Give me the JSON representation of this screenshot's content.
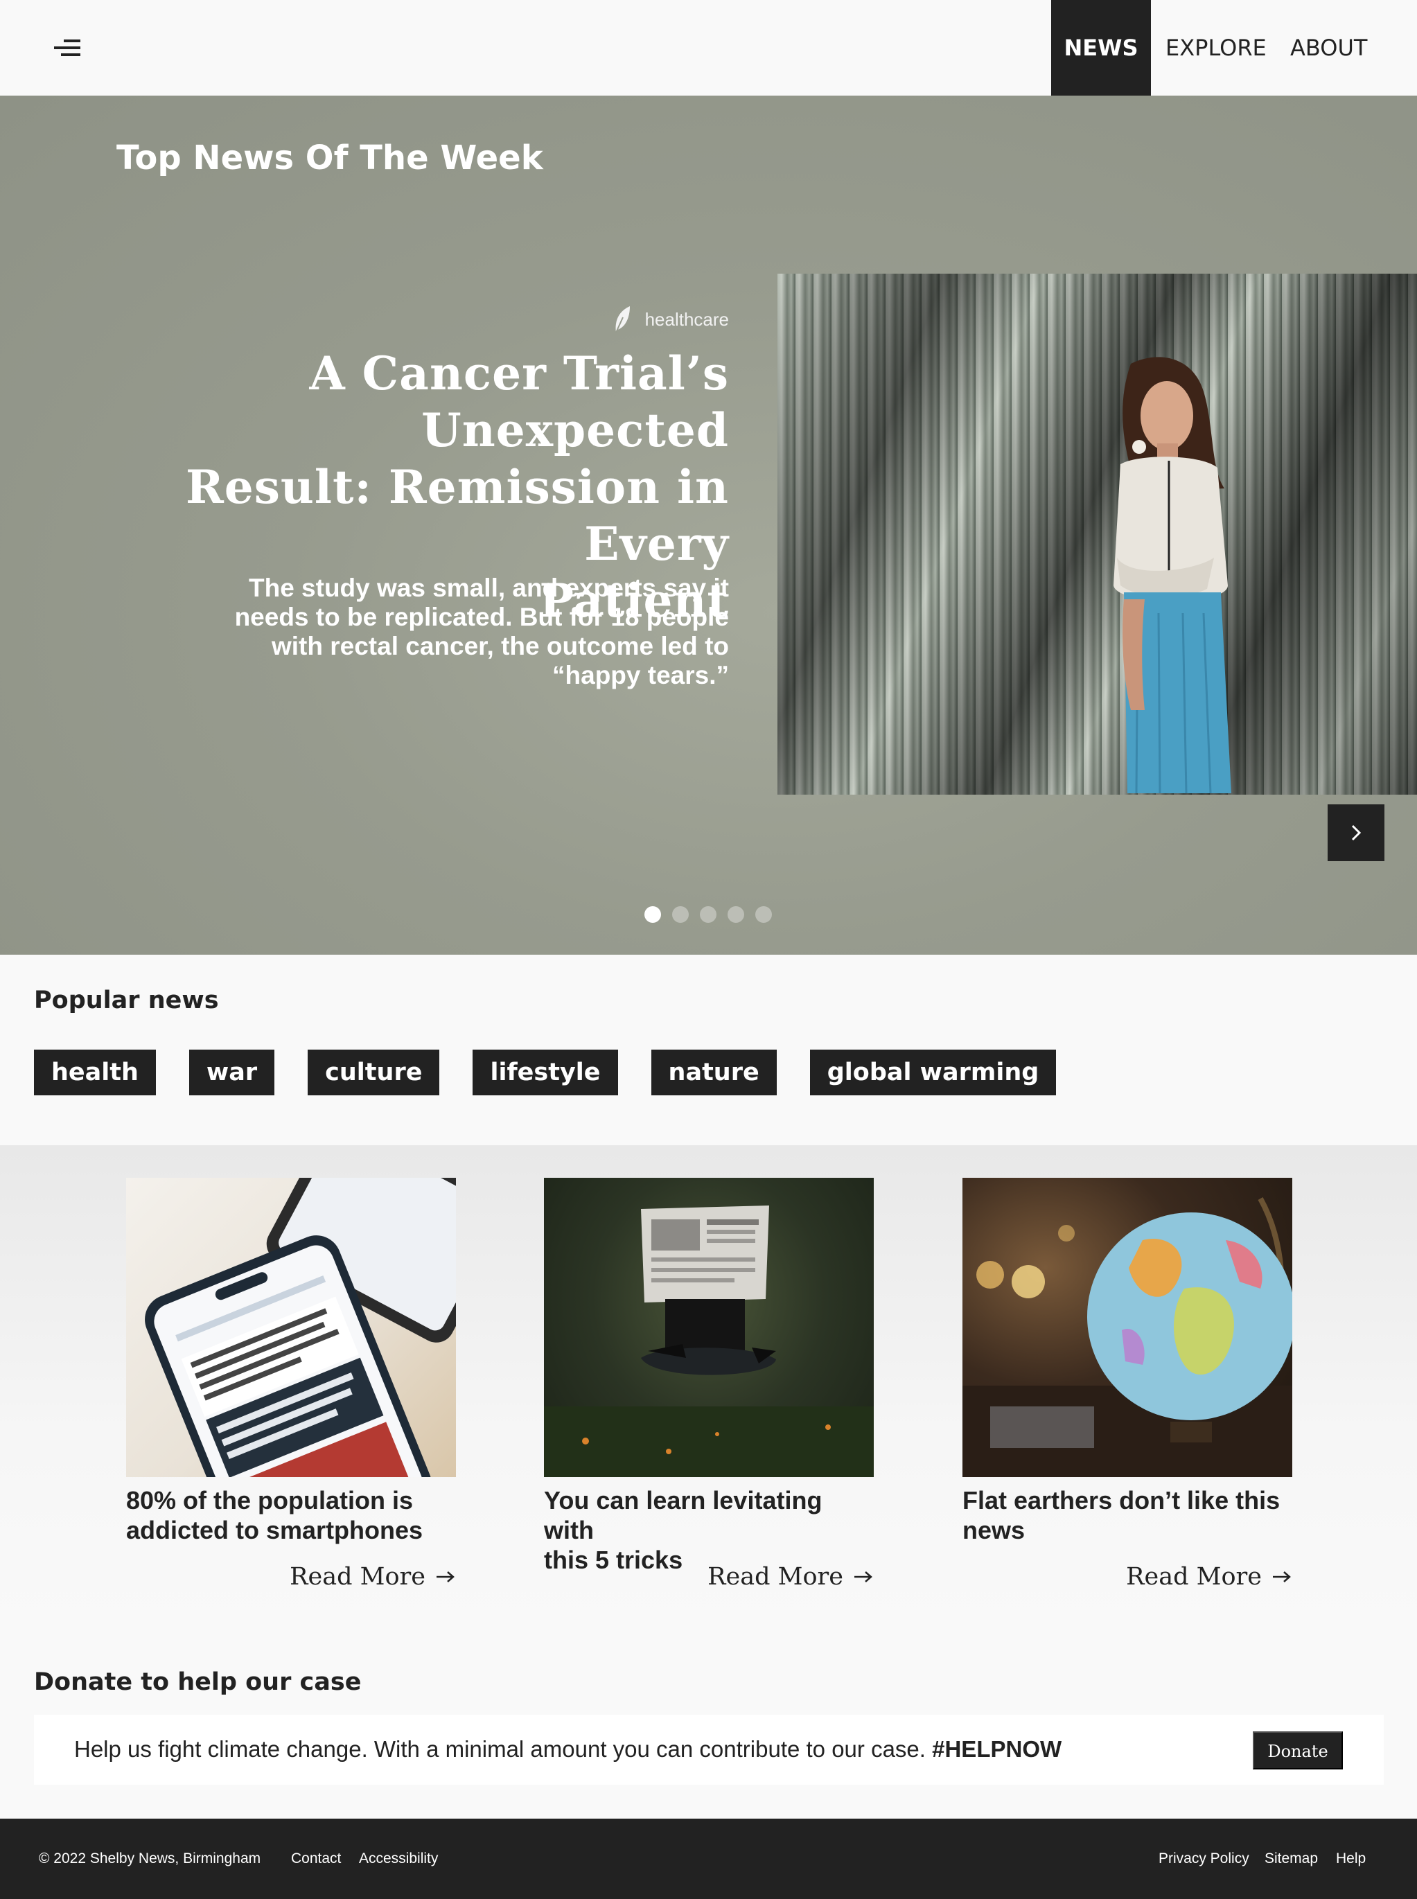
{
  "nav": {
    "items": [
      "NEWS",
      "EXPLORE",
      "ABOUT"
    ],
    "active": "NEWS"
  },
  "hero": {
    "section_title": "Top News Of The Week",
    "category": "healthcare",
    "headline_lines": [
      "A Cancer Trial’s Unexpected",
      "Result: Remission in Every",
      "Patient"
    ],
    "summary_lines": [
      "The study was small, and experts say it",
      "needs to be replicated. But for 18 people",
      "with rectal cancer, the outcome led to",
      "“happy tears.”"
    ],
    "slides_count": 5,
    "active_slide": 1
  },
  "popular": {
    "title": "Popular news",
    "tags": [
      "health",
      "war",
      "culture",
      "lifestyle",
      "nature",
      "global warming"
    ]
  },
  "cards": [
    {
      "title_lines": [
        "80% of the population is",
        "addicted to smartphones"
      ],
      "read_more": "Read More",
      "image": "smartphone-news-app"
    },
    {
      "title_lines": [
        "You can learn levitating with",
        "this 5 tricks"
      ],
      "read_more": "Read More",
      "image": "levitating-newspaper-reader"
    },
    {
      "title_lines": [
        "Flat earthers don’t like this",
        "news"
      ],
      "read_more": "Read More",
      "image": "world-globe"
    }
  ],
  "donate": {
    "title": "Donate to help our case",
    "text": "Help us fight climate change. With a minimal amount you can contribute to our case.",
    "hashtag": "#HELPNOW",
    "button": "Donate"
  },
  "footer": {
    "copyright": "© 2022 Shelby News, Birmingham",
    "left_links": [
      "Contact",
      "Accessibility"
    ],
    "right_links": [
      "Privacy Policy",
      "Sitemap",
      "Help"
    ]
  },
  "colors": {
    "dark": "#222222",
    "hero_bg": "#979b8e",
    "page_bg": "#f9f9f9"
  }
}
